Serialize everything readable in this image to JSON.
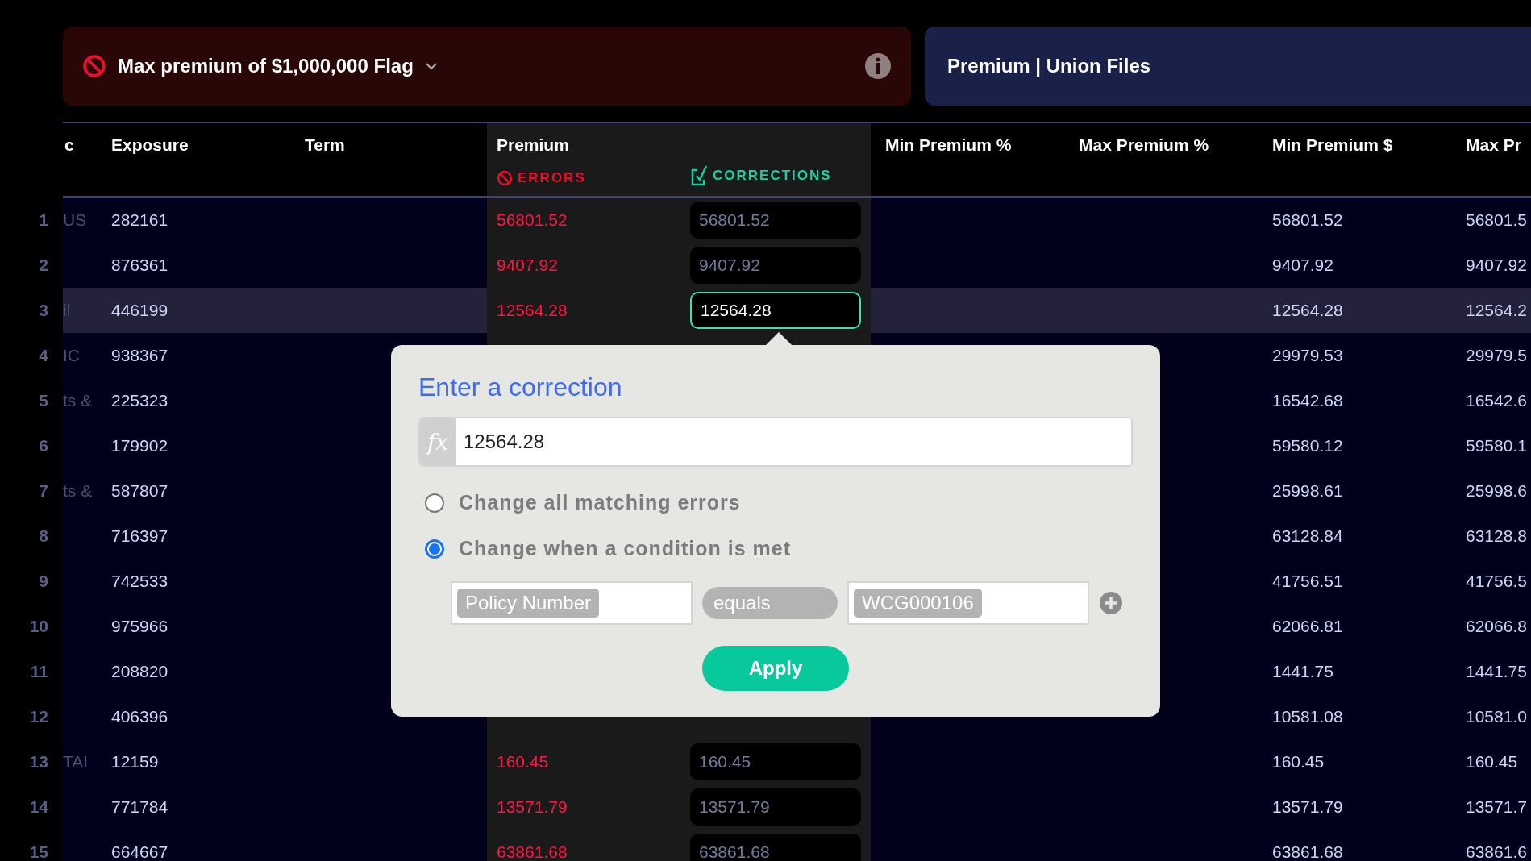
{
  "flag": {
    "title": "Max premium of $1,000,000 Flag"
  },
  "banner": {
    "title": "Premium | Union Files"
  },
  "table": {
    "columns": [
      "c",
      "Exposure",
      "Term",
      "Premium",
      "Min Premium %",
      "Max Premium %",
      "Min Premium $",
      "Max Pr"
    ],
    "errors_label": "ERRORS",
    "corrections_label": "CORRECTIONS",
    "rows": [
      {
        "number": "1",
        "column_1": "US",
        "exposure": "282161",
        "error": "56801.52",
        "correction": "56801.52",
        "min_premium_usd": "56801.52",
        "max_pr": "56801.5",
        "selected": false
      },
      {
        "number": "2",
        "exposure": "876361",
        "error": "9407.92",
        "correction": "9407.92",
        "min_premium_usd": "9407.92",
        "max_pr": "9407.92",
        "selected": false
      },
      {
        "number": "3",
        "column_1": "il",
        "exposure": "446199",
        "error": "12564.28",
        "correction": "12564.28",
        "min_premium_usd": "12564.28",
        "max_pr": "12564.2",
        "selected": true
      },
      {
        "number": "4",
        "column_1": "IC",
        "exposure": "938367",
        "min_premium_usd": "29979.53",
        "max_pr": "29979.5",
        "selected": false
      },
      {
        "number": "5",
        "column_1": "ts &",
        "exposure": "225323",
        "min_premium_usd": "16542.68",
        "max_pr": "16542.6",
        "selected": false
      },
      {
        "number": "6",
        "exposure": "179902",
        "min_premium_usd": "59580.12",
        "max_pr": "59580.1",
        "selected": false
      },
      {
        "number": "7",
        "column_1": "ts &",
        "exposure": "587807",
        "min_premium_usd": "25998.61",
        "max_pr": "25998.6",
        "selected": false
      },
      {
        "number": "8",
        "exposure": "716397",
        "min_premium_usd": "63128.84",
        "max_pr": "63128.8",
        "selected": false
      },
      {
        "number": "9",
        "exposure": "742533",
        "min_premium_usd": "41756.51",
        "max_pr": "41756.5",
        "selected": false
      },
      {
        "number": "10",
        "exposure": "975966",
        "min_premium_usd": "62066.81",
        "max_pr": "62066.8",
        "selected": false
      },
      {
        "number": "11",
        "exposure": "208820",
        "min_premium_usd": "1441.75",
        "max_pr": "1441.75",
        "selected": false
      },
      {
        "number": "12",
        "exposure": "406396",
        "min_premium_usd": "10581.08",
        "max_pr": "10581.0",
        "selected": false
      },
      {
        "number": "13",
        "column_1": "TAI",
        "exposure": "12159",
        "error": "160.45",
        "correction": "160.45",
        "min_premium_usd": "160.45",
        "max_pr": "160.45",
        "selected": false
      },
      {
        "number": "14",
        "exposure": "771784",
        "error": "13571.79",
        "correction": "13571.79",
        "min_premium_usd": "13571.79",
        "max_pr": "13571.7",
        "selected": false
      },
      {
        "number": "15",
        "exposure": "664667",
        "error": "63861.68",
        "correction": "63861.68",
        "min_premium_usd": "63861.68",
        "max_pr": "63861.6",
        "selected": false
      }
    ]
  },
  "popup": {
    "title": "Enter a correction",
    "formula_label": "fx",
    "formula_value": "12564.28",
    "options": [
      {
        "label": "Change all matching errors",
        "selected": false
      },
      {
        "label": "Change when a condition is met",
        "selected": true
      }
    ],
    "condition": {
      "field": "Policy Number",
      "operator": "equals",
      "value": "WCG000106"
    },
    "apply": "Apply"
  }
}
